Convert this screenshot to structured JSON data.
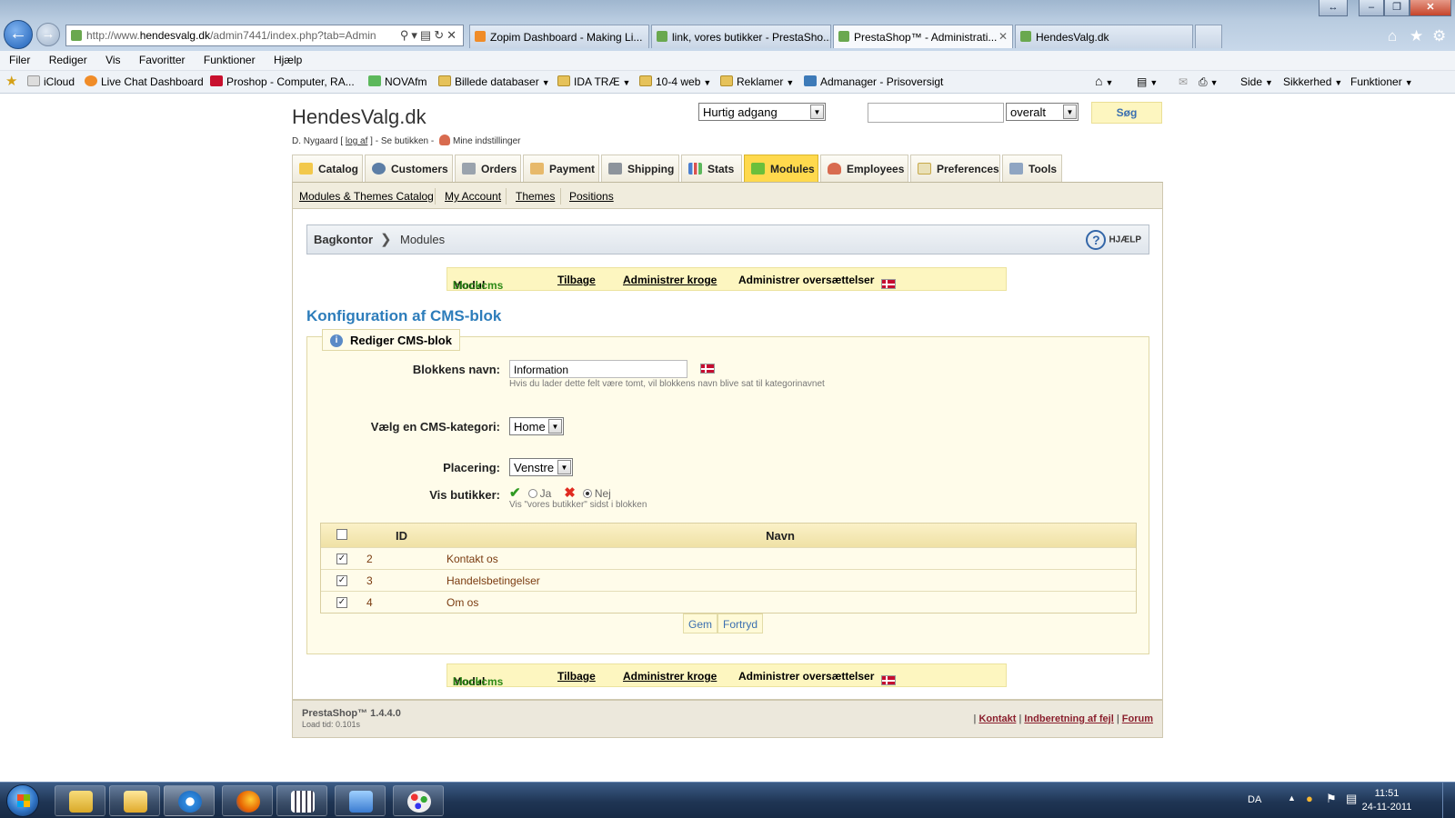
{
  "browser": {
    "address": {
      "prefix": "http://www.",
      "domain": "hendesvalg.dk",
      "path": "/admin7441/index.php?tab=Admin"
    },
    "tabs": [
      {
        "label": "Zopim Dashboard - Making Li...",
        "color": "#f08c28"
      },
      {
        "label": "link, vores butikker - PrestaSho...",
        "color": "#6aa84f"
      },
      {
        "label": "PrestaShop™ - Administrati...",
        "color": "#6aa84f",
        "active": true
      },
      {
        "label": "HendesValg.dk",
        "color": "#6aa84f"
      }
    ],
    "menu": [
      "Filer",
      "Rediger",
      "Vis",
      "Favoritter",
      "Funktioner",
      "Hjælp"
    ],
    "favorites": {
      "icloud": "iCloud",
      "live_chat": "Live Chat Dashboard",
      "proshop": "Proshop - Computer, RA...",
      "novafm": "NOVAfm",
      "billede": "Billede databaser",
      "ida": "IDA TRÆ",
      "web": "10-4 web",
      "reklamer": "Reklamer",
      "admanager": "Admanager - Prisoversigt"
    },
    "commands": {
      "side": "Side",
      "sikkerhed": "Sikkerhed",
      "funktioner": "Funktioner"
    }
  },
  "header": {
    "site_title": "HendesValg.dk",
    "user": "D. Nygaard",
    "logout": "log af",
    "see_shop": "Se butikken",
    "my_settings": "Mine indstillinger",
    "quick_access": "Hurtig adgang",
    "search_scope": "overalt",
    "search_button": "Søg"
  },
  "tabs": {
    "catalog": "Catalog",
    "customers": "Customers",
    "orders": "Orders",
    "payment": "Payment",
    "shipping": "Shipping",
    "stats": "Stats",
    "modules": "Modules",
    "employees": "Employees",
    "preferences": "Preferences",
    "tools": "Tools"
  },
  "subnav": {
    "catalog": "Modules & Themes Catalog",
    "account": "My Account",
    "themes": "Themes",
    "positions": "Positions"
  },
  "breadcrumb": {
    "root": "Bagkontor",
    "current": "Modules",
    "help": "HJÆLP"
  },
  "module_bar": {
    "label": "Modul",
    "module_name": "blockcms",
    "back": "Tilbage",
    "hooks": "Administrer kroge",
    "translations": "Administrer oversættelser"
  },
  "config": {
    "title": "Konfiguration af CMS-blok",
    "legend": "Rediger CMS-blok",
    "block_name_label": "Blokkens navn:",
    "block_name_value": "Information",
    "block_name_hint": "Hvis du lader dette felt være tomt, vil blokkens navn blive sat til kategorinavnet",
    "category_label": "Vælg en CMS-kategori:",
    "category_value": "Home",
    "placement_label": "Placering:",
    "placement_value": "Venstre",
    "show_stores_label": "Vis butikker:",
    "yes": "Ja",
    "no": "Nej",
    "show_stores_selected": "Nej",
    "show_stores_hint": "Vis \"vores butikker\" sidst i blokken"
  },
  "table": {
    "columns": {
      "id": "ID",
      "name": "Navn"
    },
    "rows": [
      {
        "id": "2",
        "name": "Kontakt os",
        "checked": true
      },
      {
        "id": "3",
        "name": "Handelsbetingelser",
        "checked": true
      },
      {
        "id": "4",
        "name": "Om os",
        "checked": true
      }
    ]
  },
  "buttons": {
    "save": "Gem",
    "cancel": "Fortryd"
  },
  "footer": {
    "version": "PrestaShop™ 1.4.4.0",
    "load_time": "Load tid: 0.101s",
    "contact": "Kontakt",
    "bug_report": "Indberetning af fejl",
    "forum": "Forum"
  },
  "taskbar": {
    "language": "DA",
    "time": "11:51",
    "date": "24-11-2011"
  }
}
